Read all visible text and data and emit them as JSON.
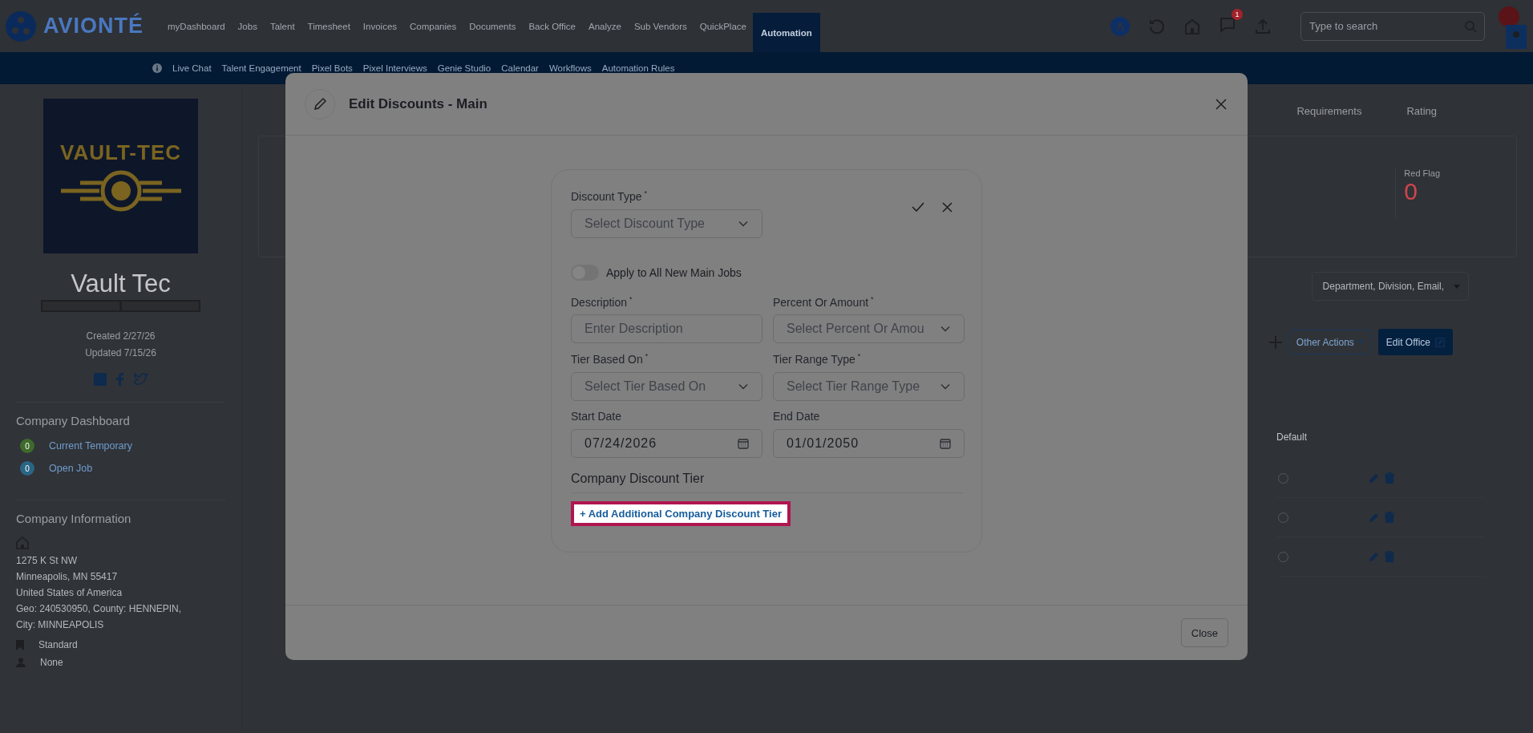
{
  "topbar": {
    "logo": "AVIONTÉ",
    "nav": [
      {
        "label": "myDashboard",
        "selected": false
      },
      {
        "label": "Jobs",
        "selected": false
      },
      {
        "label": "Talent",
        "selected": false
      },
      {
        "label": "Timesheet",
        "selected": false
      },
      {
        "label": "Invoices",
        "selected": false
      },
      {
        "label": "Companies",
        "selected": false
      },
      {
        "label": "Documents",
        "selected": false
      },
      {
        "label": "Back Office",
        "selected": false
      },
      {
        "label": "Analyze",
        "selected": false
      },
      {
        "label": "Sub Vendors",
        "selected": false
      },
      {
        "label": "QuickPlace",
        "selected": false
      },
      {
        "label": "Automation",
        "selected": true
      }
    ],
    "notification_count": "1",
    "search": {
      "placeholder": "Type to search"
    }
  },
  "subnav": [
    "Live Chat",
    "Talent Engagement",
    "Pixel Bots",
    "Pixel Interviews",
    "Genie Studio",
    "Calendar",
    "Workflows",
    "Automation Rules"
  ],
  "sidebar": {
    "logo_text": "VAULT-TEC",
    "company_name": "Vault Tec",
    "created": "Created 2/27/26",
    "updated": "Updated 7/15/26",
    "dashboard_title": "Company Dashboard",
    "dashboard_items": [
      {
        "count": "0",
        "label": "Current Temporary",
        "color": "#3f6a2c"
      },
      {
        "count": "0",
        "label": "Open Job",
        "color": "#2b6585"
      }
    ],
    "info_title": "Company Information",
    "address_lines": [
      "1275 K St NW",
      "Minneapolis, MN 55417",
      "United States of America",
      "Geo: 240530950, County: HENNEPIN,",
      "City: MINNEAPOLIS"
    ],
    "details": [
      {
        "kind": "bookmark",
        "label": "Standard"
      },
      {
        "kind": "person",
        "label": "None"
      }
    ]
  },
  "main": {
    "tabs": [
      {
        "label": "Requirements",
        "selected": false
      },
      {
        "label": "Rating",
        "selected": false
      }
    ],
    "red_flag": {
      "label": "Red Flag",
      "value": "0"
    },
    "filter": "Department, Division, Email,",
    "other_actions": "Other Actions",
    "edit_office": "Edit Office",
    "column": "Default",
    "rows": [
      {
        "selected": false
      },
      {
        "selected": false
      },
      {
        "selected": false
      }
    ]
  },
  "modal": {
    "title": "Edit Discounts - Main",
    "fields": [
      {
        "kind": "select",
        "label": "Discount Type",
        "required_mark": "*",
        "placeholder": "Select Discount Type"
      },
      {
        "kind": "toggle",
        "label": "Apply to All New Main Jobs",
        "on": false
      },
      {
        "kind": "text",
        "label": "Description",
        "required_mark": "*",
        "placeholder": "Enter Description"
      },
      {
        "kind": "select",
        "label": "Percent Or Amount",
        "required_mark": "*",
        "placeholder": "Select Percent Or Amou"
      },
      {
        "kind": "select",
        "label": "Tier Based On",
        "required_mark": "*",
        "placeholder": "Select Tier Based On"
      },
      {
        "kind": "select",
        "label": "Tier Range Type",
        "required_mark": "*",
        "placeholder": "Select Tier Range Type"
      },
      {
        "kind": "date",
        "label": "Start Date",
        "value": "07/24/2026"
      },
      {
        "kind": "date",
        "label": "End Date",
        "value": "01/01/2050"
      }
    ],
    "section_title": "Company Discount Tier",
    "add_tier": {
      "label": "+ Add Additional Company Discount Tier",
      "highlighted": true
    },
    "close": "Close"
  }
}
